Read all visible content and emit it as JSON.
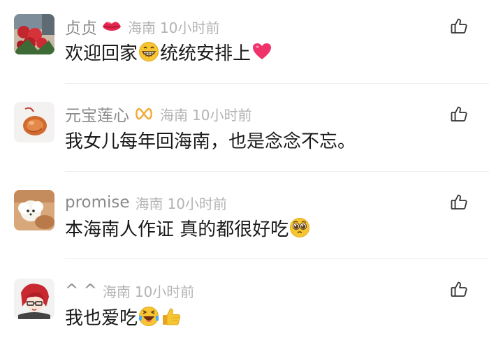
{
  "comments": [
    {
      "username": "贞贞",
      "badge_icon": "lips-icon",
      "location": "海南",
      "time": "10小时前",
      "text_parts": [
        "欢迎回家",
        "统统安排上"
      ],
      "emojis": [
        "grinning-face-icon",
        "red-heart-icon"
      ]
    },
    {
      "username": "元宝莲心",
      "badge_icon": "infinity-icon",
      "location": "海南",
      "time": "10小时前",
      "text_parts": [
        "我女儿每年回海南，也是念念不忘。"
      ],
      "emojis": []
    },
    {
      "username": "promise",
      "badge_icon": "",
      "location": "海南",
      "time": "10小时前",
      "text_parts": [
        "本海南人作证 真的都很好吃"
      ],
      "emojis": [
        "pleading-face-icon"
      ]
    },
    {
      "username": "^ ^",
      "badge_icon": "",
      "location": "海南",
      "time": "10小时前",
      "text_parts": [
        "我也爱吃"
      ],
      "emojis": [
        "laughing-tears-face-icon",
        "thumbs-up-icon"
      ]
    }
  ],
  "colors": {
    "username": "#8a8a8a",
    "meta": "#b3b3b3",
    "content": "#1a1a1a",
    "divider": "#eeeeee",
    "like_icon": "#333333",
    "heart": "#f0326a",
    "emoji_yellow": "#f7c531"
  }
}
